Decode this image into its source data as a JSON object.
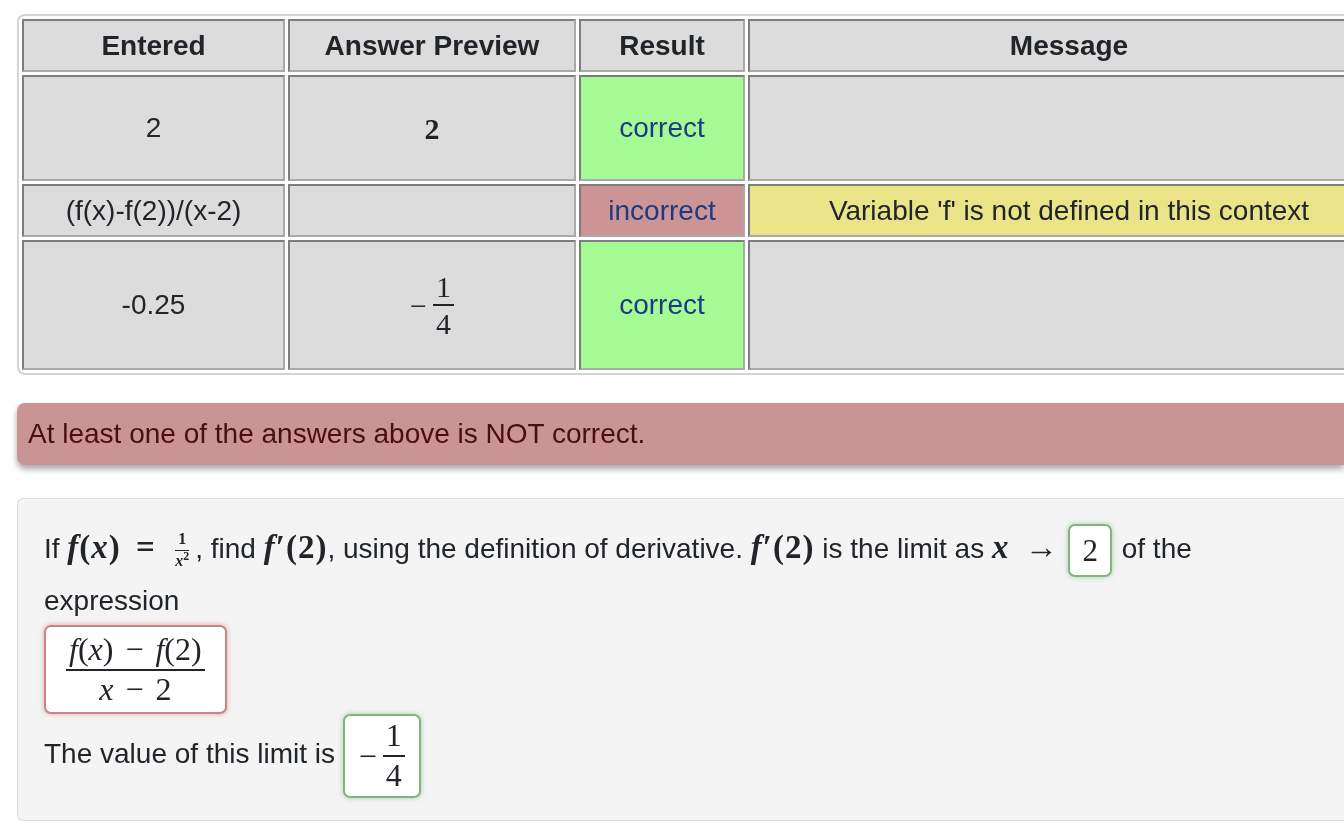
{
  "table": {
    "columns": [
      "Entered",
      "Answer Preview",
      "Result",
      "Message"
    ],
    "rows": [
      {
        "entered": "2",
        "preview": {
          "kind": "number",
          "text": "2"
        },
        "result": "correct",
        "correct": true
      },
      {
        "entered": "(f(x)-f(2))/(x-2)",
        "result": "incorrect",
        "correct": false,
        "message": "Variable 'f' is not defined in this context"
      },
      {
        "entered": "-0.25",
        "preview": {
          "kind": "fraction",
          "sign": "−",
          "numerator": "1",
          "denominator": "4"
        },
        "result": "correct",
        "correct": true
      }
    ]
  },
  "alert": {
    "text": "At least one of the answers above is NOT correct.",
    "kind": "danger"
  },
  "problem": {
    "blocks": [
      {
        "items": [
          {
            "kind": "statement",
            "pieces": [
              {
                "kind": "text",
                "text": "If "
              },
              {
                "kind": "math",
                "text": "*f*(*x*) = "
              },
              {
                "kind": "frac",
                "numerator": "1",
                "denominator": "*x*$^{2}$"
              },
              {
                "kind": "text",
                "text": ", find "
              },
              {
                "kind": "math",
                "text": "*f*′(2)"
              },
              {
                "kind": "text",
                "text": ", using the definition of derivative. "
              },
              {
                "kind": "math",
                "text": "*f*′(2)"
              },
              {
                "kind": "text",
                "text": " is the limit as "
              },
              {
                "kind": "math",
                "text": "*x* →"
              }
            ]
          },
          {
            "kind": "answer",
            "value": "2",
            "correct": true
          },
          {
            "kind": "statement",
            "pieces": [
              {
                "kind": "text",
                "text": "of the"
              }
            ]
          },
          {
            "kind": "statement",
            "pieces": [
              {
                "kind": "text",
                "text": "expression"
              }
            ]
          }
        ]
      },
      {
        "items": [
          {
            "kind": "answer",
            "fraction": {
              "numerator": "*f*(*x*) − *f*(2)",
              "denominator": "*x* − 2"
            },
            "correct": false
          }
        ]
      },
      {
        "items": [
          {
            "kind": "statement",
            "pieces": [
              {
                "kind": "text",
                "text": "The value of this limit is"
              }
            ]
          },
          {
            "kind": "answer",
            "fraction": {
              "sign": "−",
              "numerator": "1",
              "denominator": "4"
            },
            "correct": true
          }
        ]
      }
    ]
  }
}
